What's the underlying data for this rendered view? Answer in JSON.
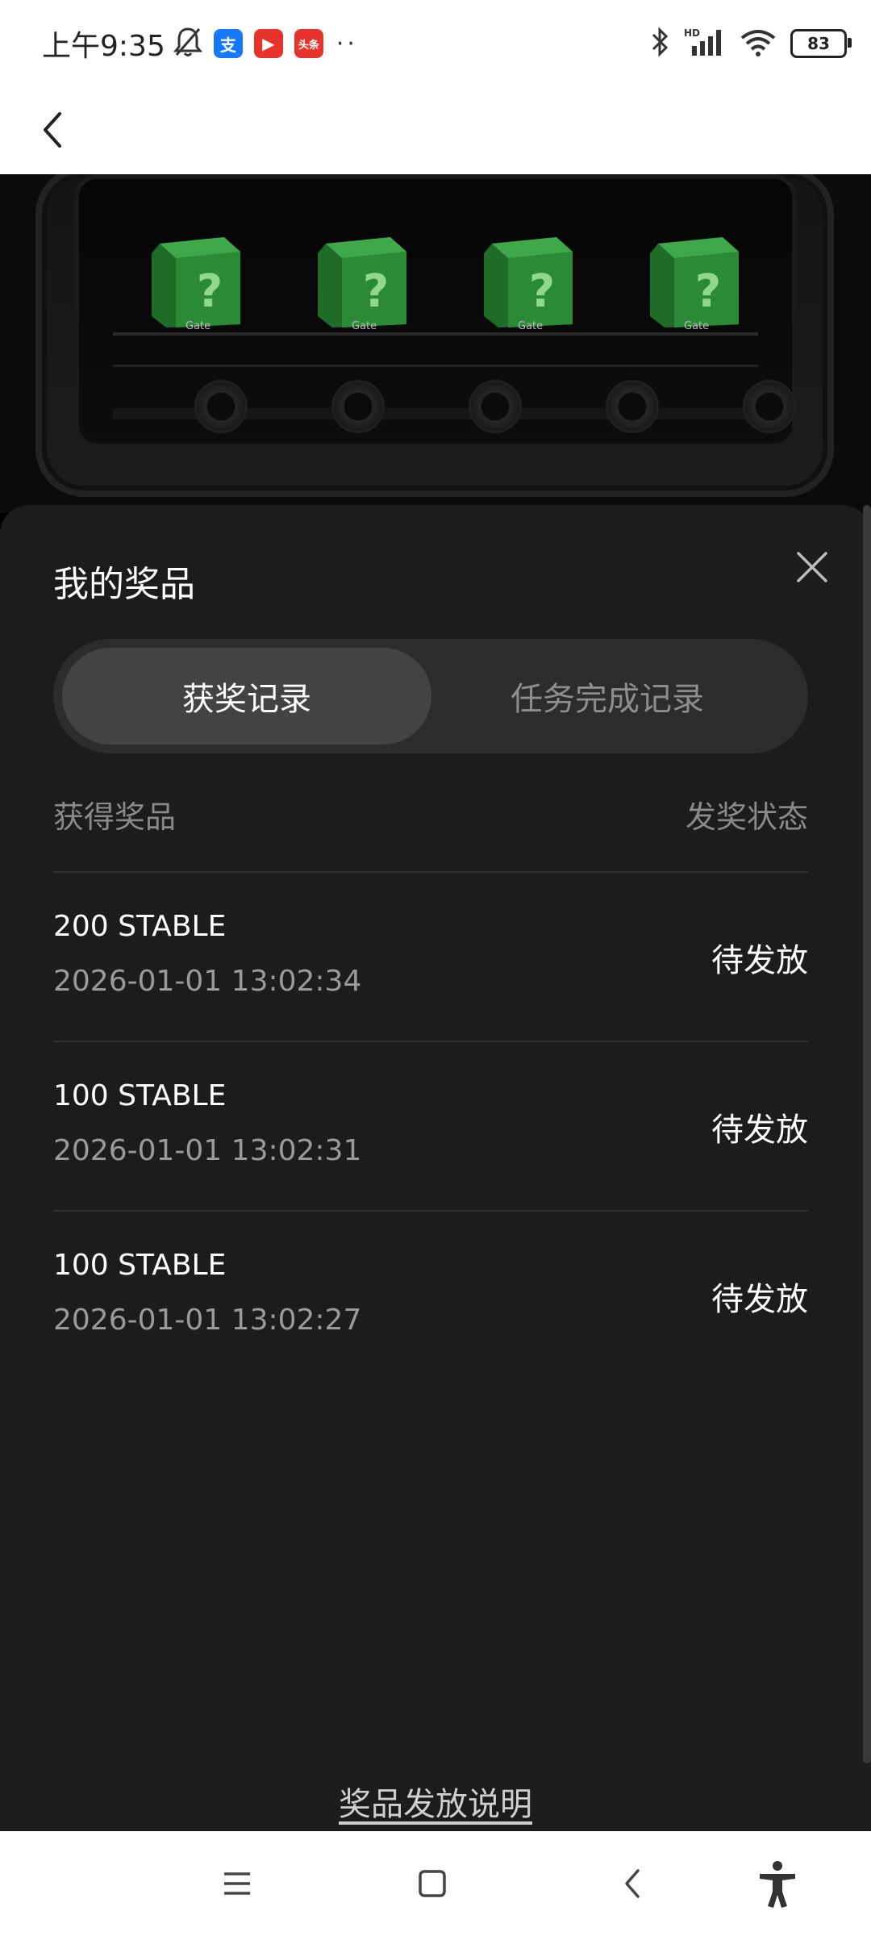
{
  "status_bar": {
    "time": "上午9:35",
    "app_icons": [
      {
        "name": "alipay-icon",
        "glyph": "支",
        "color": "#1677ff"
      },
      {
        "name": "video-app-icon",
        "glyph": "▶",
        "color": "#e8332c"
      },
      {
        "name": "toutiao-icon",
        "glyph": "头条",
        "color": "#e8332c"
      }
    ],
    "more": "··",
    "battery": "83"
  },
  "sheet": {
    "title": "我的奖品",
    "tabs": [
      {
        "label": "获奖记录",
        "active": true
      },
      {
        "label": "任务完成记录",
        "active": false
      }
    ],
    "columns": {
      "prize": "获得奖品",
      "status": "发奖状态"
    },
    "records": [
      {
        "amount": "200 STABLE",
        "time": "2026-01-01 13:02:34",
        "status": "待发放"
      },
      {
        "amount": "100 STABLE",
        "time": "2026-01-01 13:02:31",
        "status": "待发放"
      },
      {
        "amount": "100 STABLE",
        "time": "2026-01-01 13:02:27",
        "status": "待发放"
      }
    ],
    "footer_link": "奖品发放说明"
  },
  "hero": {
    "box_brand": "Gate",
    "box_glyph": "?"
  }
}
